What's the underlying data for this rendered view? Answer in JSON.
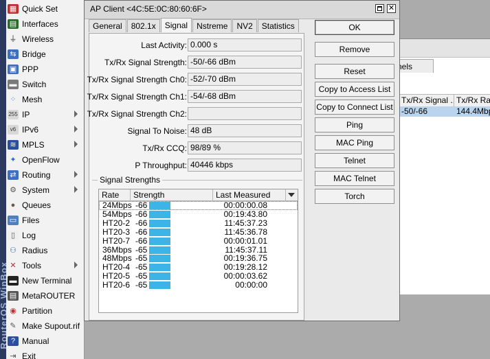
{
  "sidebar": {
    "brand": "RouterOS WinBox",
    "items": [
      {
        "label": "Quick Set",
        "icon": "quick-set-icon",
        "arrow": false
      },
      {
        "label": "Interfaces",
        "icon": "interfaces-icon",
        "arrow": false
      },
      {
        "label": "Wireless",
        "icon": "wireless-icon",
        "arrow": false
      },
      {
        "label": "Bridge",
        "icon": "bridge-icon",
        "arrow": false
      },
      {
        "label": "PPP",
        "icon": "ppp-icon",
        "arrow": false
      },
      {
        "label": "Switch",
        "icon": "switch-icon",
        "arrow": false
      },
      {
        "label": "Mesh",
        "icon": "mesh-icon",
        "arrow": false
      },
      {
        "label": "IP",
        "icon": "ip-icon",
        "arrow": true
      },
      {
        "label": "IPv6",
        "icon": "ipv6-icon",
        "arrow": true
      },
      {
        "label": "MPLS",
        "icon": "mpls-icon",
        "arrow": true
      },
      {
        "label": "OpenFlow",
        "icon": "openflow-icon",
        "arrow": false
      },
      {
        "label": "Routing",
        "icon": "routing-icon",
        "arrow": true
      },
      {
        "label": "System",
        "icon": "system-icon",
        "arrow": true
      },
      {
        "label": "Queues",
        "icon": "queues-icon",
        "arrow": false
      },
      {
        "label": "Files",
        "icon": "files-icon",
        "arrow": false
      },
      {
        "label": "Log",
        "icon": "log-icon",
        "arrow": false
      },
      {
        "label": "Radius",
        "icon": "radius-icon",
        "arrow": false
      },
      {
        "label": "Tools",
        "icon": "tools-icon",
        "arrow": true
      },
      {
        "label": "New Terminal",
        "icon": "terminal-icon",
        "arrow": false
      },
      {
        "label": "MetaROUTER",
        "icon": "metarouter-icon",
        "arrow": false
      },
      {
        "label": "Partition",
        "icon": "partition-icon",
        "arrow": false
      },
      {
        "label": "Make Supout.rif",
        "icon": "supout-icon",
        "arrow": false
      },
      {
        "label": "Manual",
        "icon": "manual-icon",
        "arrow": false
      },
      {
        "label": "Exit",
        "icon": "exit-icon",
        "arrow": false
      }
    ]
  },
  "background_window": {
    "tab_label": "nels",
    "col1": "Tx/Rx Signal ...",
    "col2": "Tx/Rx Ra",
    "row_val1": "-50/-66",
    "row_val2": "144.4Mbp"
  },
  "dialog": {
    "title": "AP Client <4C:5E:0C:80:60:6F>",
    "close_glyph": "✕",
    "tabs": [
      "General",
      "802.1x",
      "Signal",
      "Nstreme",
      "NV2",
      "Statistics"
    ],
    "active_tab": "Signal",
    "fields": [
      {
        "label": "Last Activity:",
        "value": "0.000 s"
      },
      {
        "label": "Tx/Rx Signal Strength:",
        "value": "-50/-66 dBm"
      },
      {
        "label": "Tx/Rx Signal Strength Ch0:",
        "value": "-52/-70 dBm"
      },
      {
        "label": "Tx/Rx Signal Strength Ch1:",
        "value": "-54/-68 dBm"
      },
      {
        "label": "Tx/Rx Signal Strength Ch2:",
        "value": ""
      },
      {
        "label": "Signal To Noise:",
        "value": "48 dB"
      },
      {
        "label": "Tx/Rx CCQ:",
        "value": "98/89 %"
      },
      {
        "label": "P Throughput:",
        "value": "40446 kbps"
      }
    ],
    "group_title": "Signal Strengths",
    "table": {
      "headers": [
        "Rate",
        "Strength",
        "Last Measured"
      ],
      "rows": [
        {
          "rate": "24Mbps",
          "strength": "-66",
          "last": "00:00:00.08"
        },
        {
          "rate": "54Mbps",
          "strength": "-66",
          "last": "00:19:43.80"
        },
        {
          "rate": "HT20-2",
          "strength": "-66",
          "last": "11:45:37.23"
        },
        {
          "rate": "HT20-3",
          "strength": "-66",
          "last": "11:45:36.78"
        },
        {
          "rate": "HT20-7",
          "strength": "-66",
          "last": "00:00:01.01"
        },
        {
          "rate": "36Mbps",
          "strength": "-65",
          "last": "11:45:37.11"
        },
        {
          "rate": "48Mbps",
          "strength": "-65",
          "last": "00:19:36.75"
        },
        {
          "rate": "HT20-4",
          "strength": "-65",
          "last": "00:19:28.12"
        },
        {
          "rate": "HT20-5",
          "strength": "-65",
          "last": "00:00:03.62"
        },
        {
          "rate": "HT20-6",
          "strength": "-65",
          "last": "00:00:00"
        }
      ]
    },
    "buttons": [
      "OK",
      "Remove",
      "Reset",
      "Copy to Access List",
      "Copy to Connect List",
      "Ping",
      "MAC Ping",
      "Telnet",
      "MAC Telnet",
      "Torch"
    ]
  },
  "colors": {
    "bar": "#3cb4e6",
    "desktop": "#ababab",
    "selection": "#b9d4ec"
  }
}
